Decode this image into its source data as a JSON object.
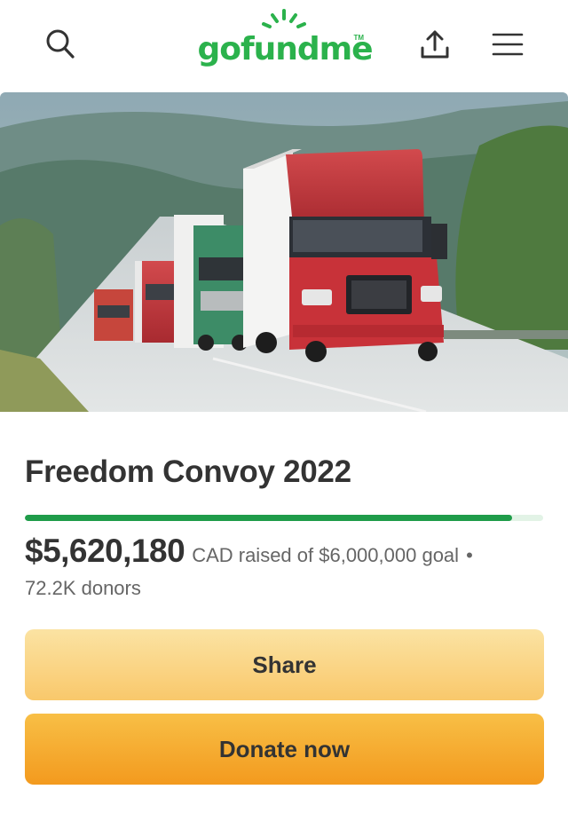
{
  "header": {
    "logo_text": "gofundme",
    "logo_tm": "TM",
    "icons": {
      "search": "search-icon",
      "share": "share-upload-icon",
      "menu": "hamburger-menu-icon"
    }
  },
  "hero": {
    "image": "convoy-of-trucks-on-highway-photo"
  },
  "campaign": {
    "title": "Freedom Convoy 2022",
    "raised_amount": "$5,620,180",
    "raised_text": "CAD raised of $6,000,000 goal",
    "bullet": "•",
    "donors": "72.2K donors",
    "progress": 0.94
  },
  "actions": {
    "share_label": "Share",
    "donate_label": "Donate now"
  },
  "colors": {
    "brand_green": "#2bb24c",
    "progress_green": "#1f9c4a",
    "share_button": "#f9d27f",
    "donate_button": "#f5a92c"
  }
}
